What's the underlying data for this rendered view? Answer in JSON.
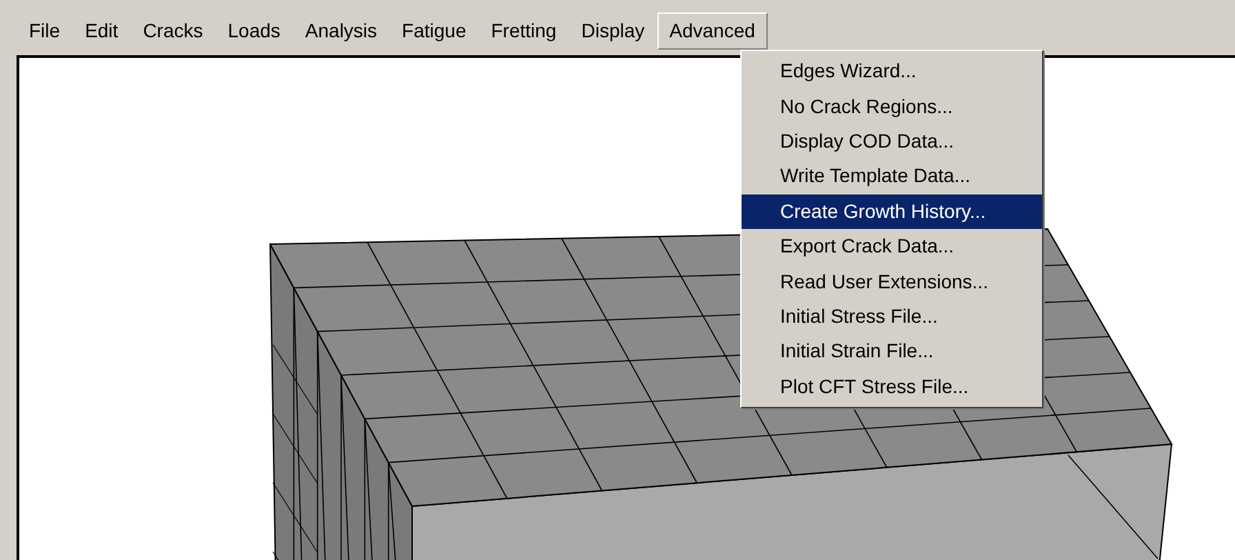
{
  "menu_bar": [
    {
      "label": "File",
      "selected": false
    },
    {
      "label": "Edit",
      "selected": false
    },
    {
      "label": "Cracks",
      "selected": false
    },
    {
      "label": "Loads",
      "selected": false
    },
    {
      "label": "Analysis",
      "selected": false
    },
    {
      "label": "Fatigue",
      "selected": false
    },
    {
      "label": "Fretting",
      "selected": false
    },
    {
      "label": "Display",
      "selected": false
    },
    {
      "label": "Advanced",
      "selected": true
    }
  ],
  "dropdown_menu": [
    {
      "label": "Edges Wizard...",
      "selected": false
    },
    {
      "label": "No Crack Regions...",
      "selected": false
    },
    {
      "label": "Display COD Data...",
      "selected": false
    },
    {
      "label": "Write Template Data...",
      "selected": false
    },
    {
      "label": "Create Growth History...",
      "selected": true
    },
    {
      "label": "Export Crack Data...",
      "selected": false
    },
    {
      "label": "Read User Extensions...",
      "selected": false
    },
    {
      "label": "Initial Stress File...",
      "selected": false
    },
    {
      "label": "Initial Strain File...",
      "selected": false
    },
    {
      "label": "Plot CFT Stress File...",
      "selected": false
    }
  ]
}
